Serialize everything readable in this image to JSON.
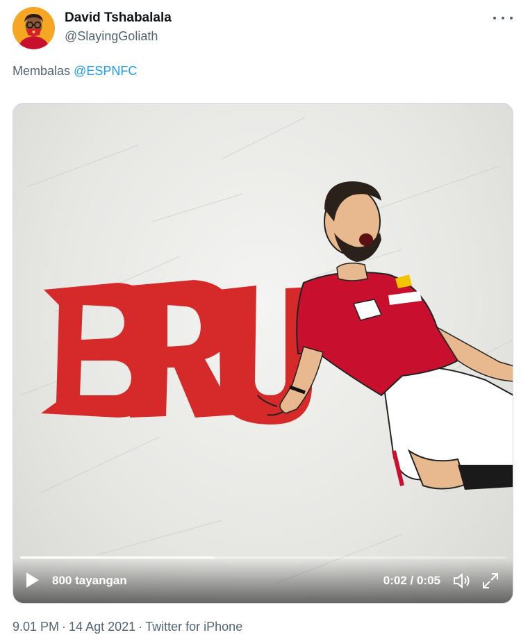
{
  "tweet": {
    "author": {
      "display_name": "David Tshabalala",
      "handle": "@SlayingGoliath",
      "avatar_icon": "user-avatar"
    },
    "reply_prefix": "Membalas",
    "reply_to": "@ESPNFC",
    "media": {
      "overlay_text": "BRU",
      "views": "800 tayangan",
      "time_display": "0:02 / 0:05",
      "progress": 0.4,
      "icons": [
        "play-icon",
        "volume-icon",
        "fullscreen-icon"
      ]
    },
    "meta": {
      "time": "9.01 PM",
      "date": "14 Agt 2021",
      "source": "Twitter for iPhone"
    }
  },
  "colors": {
    "text_primary": "#0f1419",
    "text_secondary": "#536471",
    "link": "#1d9bf0",
    "brush_red": "#d62a2a"
  }
}
